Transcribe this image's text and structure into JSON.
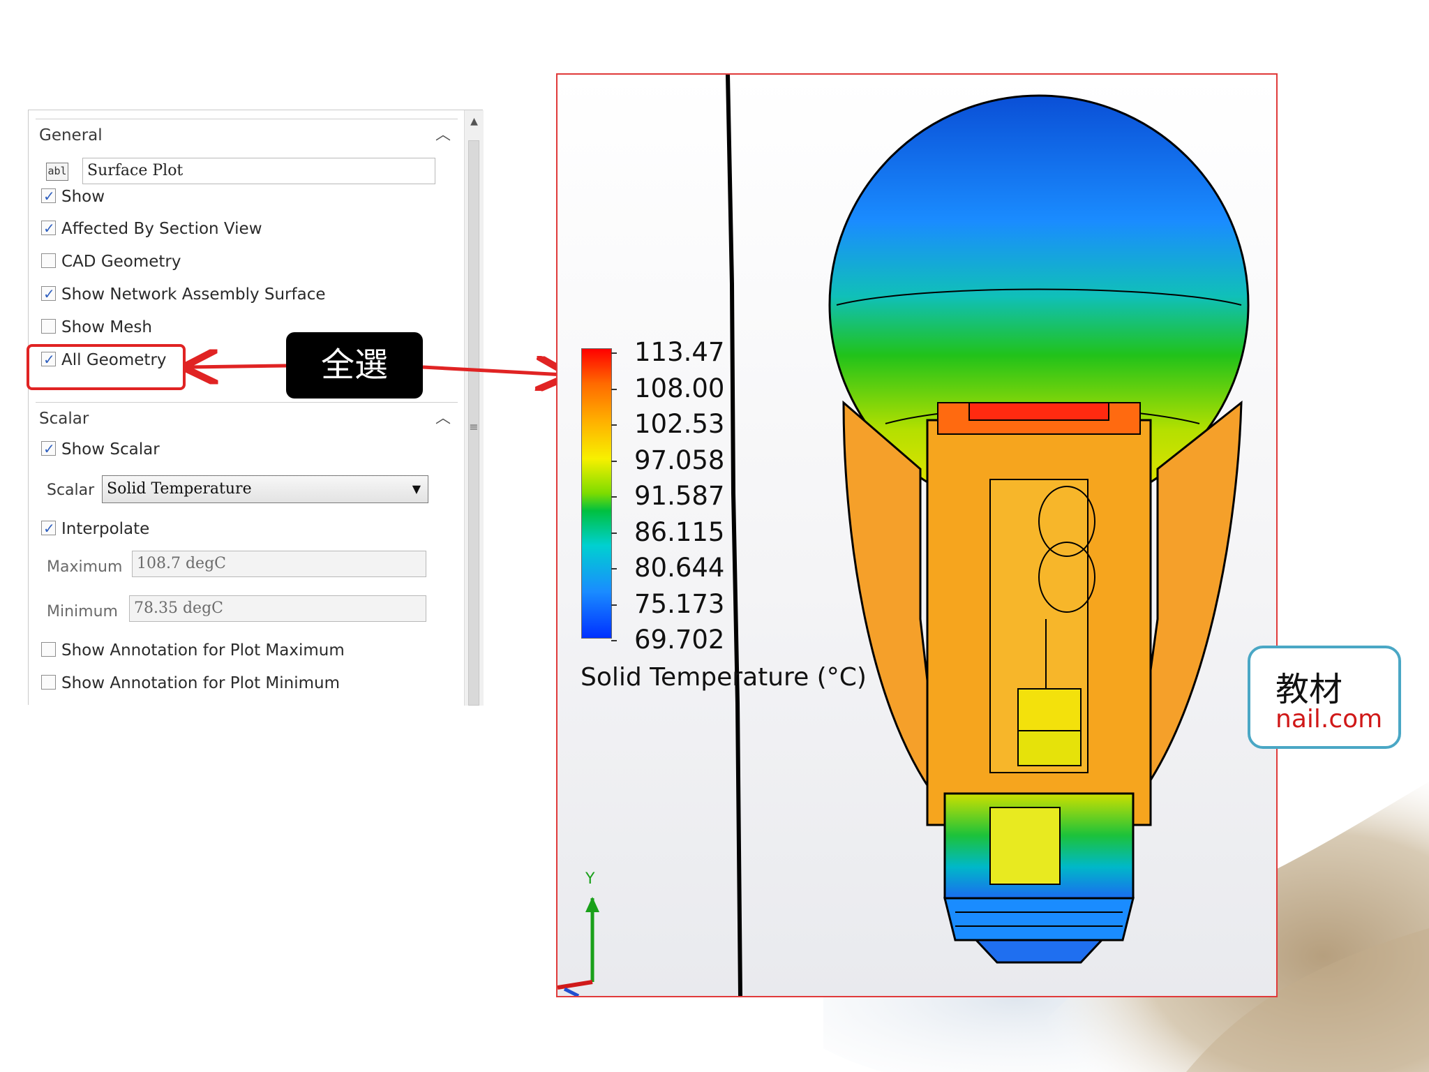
{
  "panel": {
    "general": {
      "title": "General",
      "name_icon": "abl",
      "name_value": "Surface Plot",
      "checkboxes": [
        {
          "label": "Show",
          "checked": true
        },
        {
          "label": "Affected By Section View",
          "checked": true
        },
        {
          "label": "CAD Geometry",
          "checked": false
        },
        {
          "label": "Show Network Assembly Surface",
          "checked": true
        },
        {
          "label": "Show Mesh",
          "checked": false
        },
        {
          "label": "All Geometry",
          "checked": true
        }
      ]
    },
    "scalar": {
      "title": "Scalar",
      "show_scalar": {
        "label": "Show Scalar",
        "checked": true
      },
      "scalar_label": "Scalar",
      "scalar_value": "Solid Temperature",
      "interpolate": {
        "label": "Interpolate",
        "checked": true
      },
      "maximum_label": "Maximum",
      "maximum_value": "108.7 degC",
      "minimum_label": "Minimum",
      "minimum_value": "78.35 degC",
      "annotation_max": {
        "label": "Show Annotation for Plot Maximum",
        "checked": false
      },
      "annotation_min": {
        "label": "Show Annotation for Plot Minimum",
        "checked": false
      }
    }
  },
  "callout": {
    "text": "全選",
    "highlight_color": "#e02323"
  },
  "visualization": {
    "legend_title": "Solid Temperature (°C)",
    "legend_values": [
      "113.47",
      "108.00",
      "102.53",
      "97.058",
      "91.587",
      "86.115",
      "80.644",
      "75.173",
      "69.702"
    ],
    "axis_label": "Y"
  },
  "card": {
    "line1": "教材",
    "line2": "nail.com",
    "border_color": "#4aa7c5"
  }
}
